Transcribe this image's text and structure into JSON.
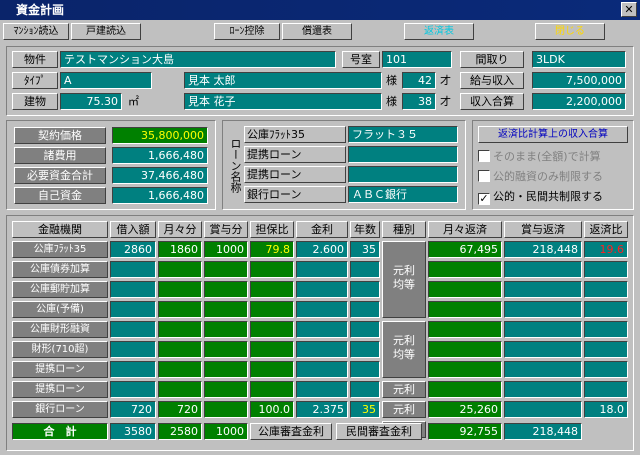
{
  "window": {
    "title": "資金計画",
    "close": "✕"
  },
  "toolbar": {
    "b1": "ﾏﾝｼｮﾝ読込",
    "b2": "戸建読込",
    "b3": "ﾛｰﾝ控除",
    "b4": "償還表",
    "b5": "返済表",
    "b6": "閉じる"
  },
  "property": {
    "name_label": "物件",
    "name": "テストマンション大島",
    "room_label": "号室",
    "room": "101",
    "layout_label": "間取り",
    "layout": "3LDK",
    "type_label": "ﾀｲﾌﾟ",
    "type": "A",
    "person1": "見本 太郎",
    "sama1": "様",
    "age1": "42",
    "sai1": "才",
    "salary_label": "給与収入",
    "salary": "7,500,000",
    "bldg_label": "建物",
    "bldg": "75.30",
    "unit": "㎡",
    "person2": "見本 花子",
    "sama2": "様",
    "age2": "38",
    "sai2": "才",
    "income_label": "収入合算",
    "income": "2,200,000"
  },
  "funds": {
    "contract_label": "契約価格",
    "contract": "35,800,000",
    "cost_label": "諸費用",
    "cost": "1,666,480",
    "need_label": "必要資金合計",
    "need": "37,466,480",
    "own_label": "自己資金",
    "own": "1,666,480"
  },
  "loans": {
    "side": "ローン名称",
    "rows": [
      {
        "label": "公庫ﾌﾗｯﾄ35",
        "value": "フラット３５"
      },
      {
        "label": "提携ローン",
        "value": ""
      },
      {
        "label": "提携ローン",
        "value": ""
      },
      {
        "label": "銀行ローン",
        "value": "ＡＢＣ銀行"
      }
    ]
  },
  "options": {
    "calc_button": "返済比計算上の収入合算",
    "c1": "そのまま(全額)で計算",
    "c1_checked": "",
    "c2": "公的融資のみ制限する",
    "c2_checked": "",
    "c3": "公的・民間共制限する",
    "c3_checked": "✓"
  },
  "table": {
    "headers": [
      "金融機関",
      "借入額",
      "月々分",
      "賞与分",
      "担保比",
      "金利",
      "年数",
      "種別",
      "月々返済",
      "賞与返済",
      "返済比"
    ],
    "rows": [
      {
        "label": "公庫ﾌﾗｯﾄ35",
        "loan": "2860",
        "monthly": "1860",
        "bonus": "1000",
        "ratio": "79.8",
        "rate": "2.600",
        "years": "35",
        "m_pay": "67,495",
        "b_pay": "218,448",
        "pay_ratio": "19.6"
      },
      {
        "label": "公庫債券加算",
        "loan": "",
        "monthly": "",
        "bonus": "",
        "ratio": "",
        "rate": "",
        "years": "",
        "m_pay": "",
        "b_pay": "",
        "pay_ratio": ""
      },
      {
        "label": "公庫郵貯加算",
        "loan": "",
        "monthly": "",
        "bonus": "",
        "ratio": "",
        "rate": "",
        "years": "",
        "m_pay": "",
        "b_pay": "",
        "pay_ratio": ""
      },
      {
        "label": "公庫(予備)",
        "loan": "",
        "monthly": "",
        "bonus": "",
        "ratio": "",
        "rate": "",
        "years": "",
        "m_pay": "",
        "b_pay": "",
        "pay_ratio": ""
      },
      {
        "label": "公庫財形融資",
        "loan": "",
        "monthly": "",
        "bonus": "",
        "ratio": "",
        "rate": "",
        "years": "",
        "m_pay": "",
        "b_pay": "",
        "pay_ratio": ""
      },
      {
        "label": "財形(710超)",
        "loan": "",
        "monthly": "",
        "bonus": "",
        "ratio": "",
        "rate": "",
        "years": "",
        "m_pay": "",
        "b_pay": "",
        "pay_ratio": ""
      },
      {
        "label": "提携ローン",
        "loan": "",
        "monthly": "",
        "bonus": "",
        "ratio": "",
        "rate": "",
        "years": "",
        "m_pay": "",
        "b_pay": "",
        "pay_ratio": ""
      },
      {
        "label": "提携ローン",
        "loan": "",
        "monthly": "",
        "bonus": "",
        "ratio": "",
        "rate": "",
        "years": "",
        "m_pay": "",
        "b_pay": "",
        "pay_ratio": ""
      },
      {
        "label": "銀行ローン",
        "loan": "720",
        "monthly": "720",
        "bonus": "",
        "ratio": "100.0",
        "rate": "2.375",
        "years": "35",
        "m_pay": "25,260",
        "b_pay": "",
        "pay_ratio": "18.0"
      }
    ],
    "type_a": "元利\n均等",
    "type_b": "元利\n均等",
    "type_c": "元利",
    "type_d": "元利",
    "type_e": "元利",
    "total": {
      "label": "合　計",
      "loan": "3580",
      "monthly": "2580",
      "bonus": "1000",
      "koko_label": "公庫審査金利",
      "minkan_label": "民間審査金利",
      "m_pay": "92,755",
      "b_pay": "218,448"
    }
  }
}
